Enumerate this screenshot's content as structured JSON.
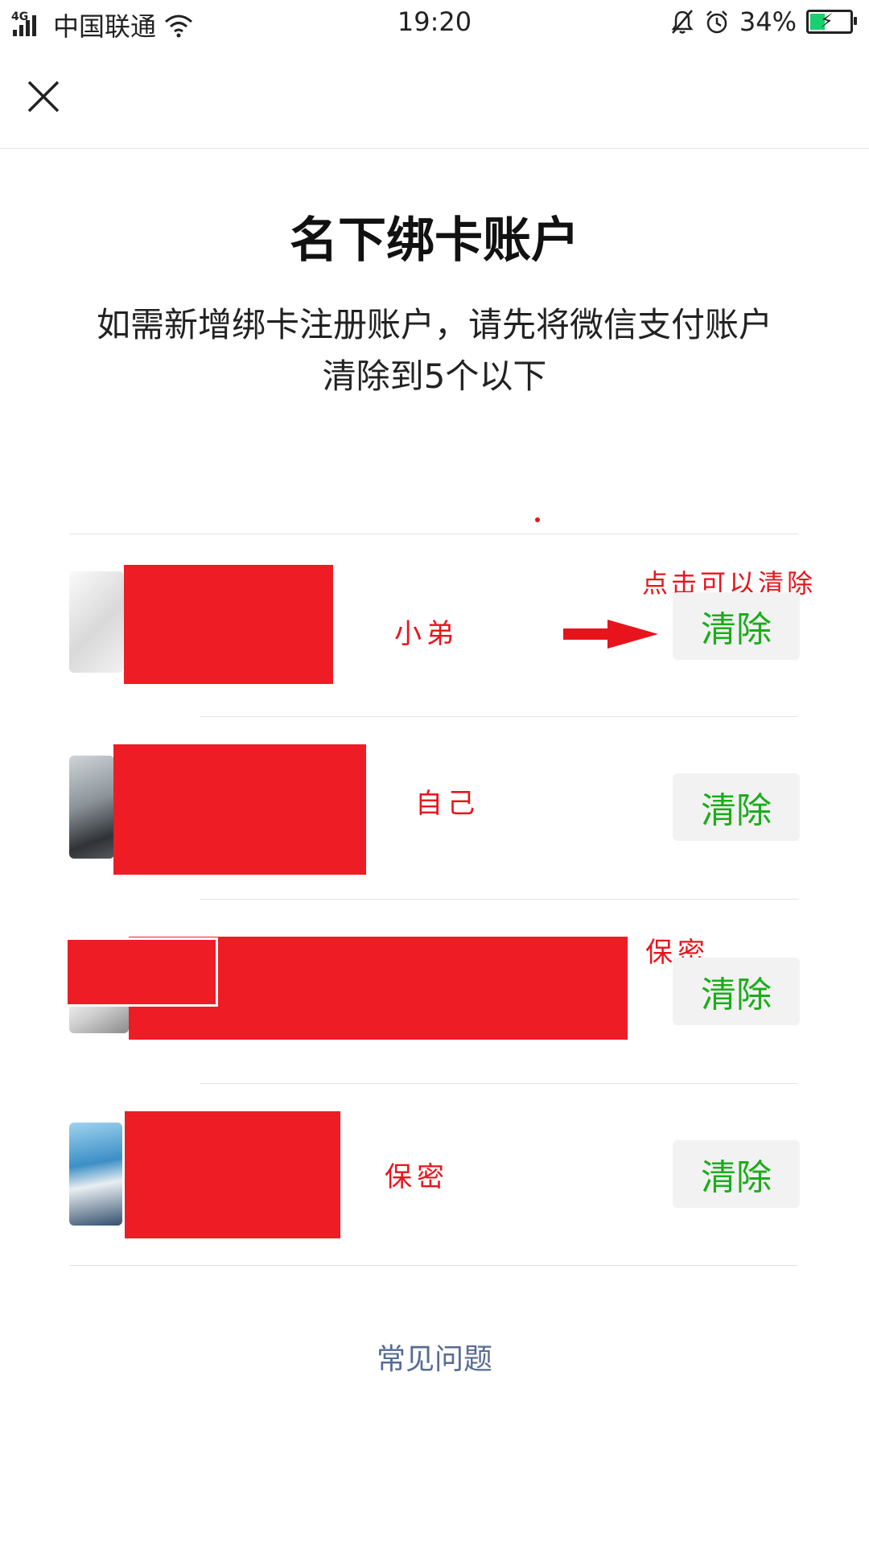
{
  "status_bar": {
    "network": "4G",
    "carrier": "中国联通",
    "time": "19:20",
    "battery": "34%",
    "battery_color": "#19d06e"
  },
  "nav": {
    "close_icon": "close-icon"
  },
  "page": {
    "title": "名下绑卡账户",
    "description": "如需新增绑卡注册账户，请先将微信支付账户清除到5个以下"
  },
  "accounts": [
    {
      "note": "小弟",
      "clear_label": "清除"
    },
    {
      "note": "自己",
      "clear_label": "清除"
    },
    {
      "note": "保密",
      "clear_label": "清除"
    },
    {
      "note": "保密",
      "clear_label": "清除"
    }
  ],
  "annotations": {
    "hint": "点击可以清除",
    "arrow_icon": "right-arrow-icon",
    "color": "#e8141c"
  },
  "redaction_color": "#ee1c25",
  "accent_color": "#1aad19",
  "faq_label": "常见问题"
}
